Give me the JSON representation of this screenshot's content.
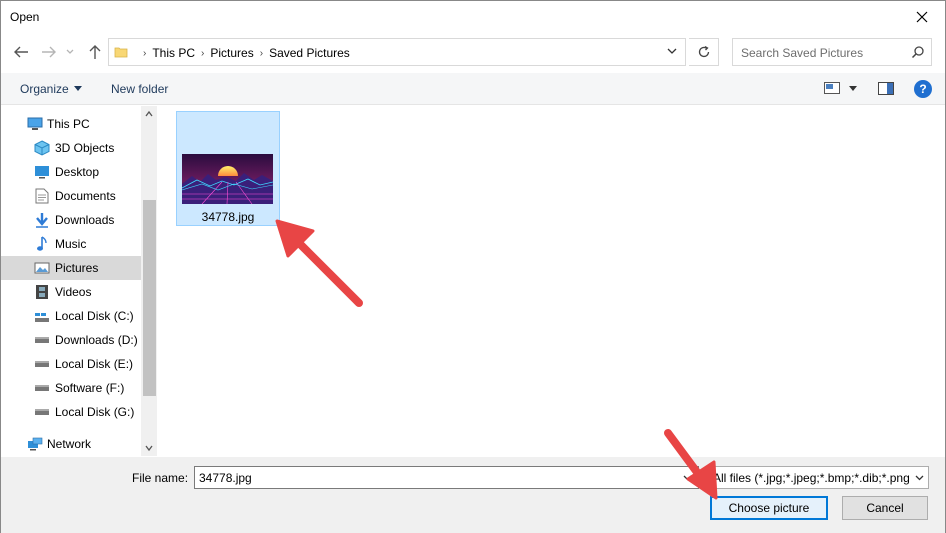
{
  "window": {
    "title": "Open"
  },
  "address": {
    "crumbs": [
      "This PC",
      "Pictures",
      "Saved Pictures"
    ]
  },
  "search": {
    "placeholder": "Search Saved Pictures"
  },
  "toolbar": {
    "organize_label": "Organize",
    "new_folder_label": "New folder",
    "help_label": "?"
  },
  "nav": {
    "items": [
      {
        "label": "This PC",
        "icon": "computer-icon"
      },
      {
        "label": "3D Objects",
        "icon": "cube-icon"
      },
      {
        "label": "Desktop",
        "icon": "desktop-icon"
      },
      {
        "label": "Documents",
        "icon": "document-icon"
      },
      {
        "label": "Downloads",
        "icon": "download-arrow-icon"
      },
      {
        "label": "Music",
        "icon": "music-note-icon"
      },
      {
        "label": "Pictures",
        "icon": "pictures-icon",
        "selected": true
      },
      {
        "label": "Videos",
        "icon": "film-icon"
      },
      {
        "label": "Local Disk (C:)",
        "icon": "windows-drive-icon"
      },
      {
        "label": "Downloads  (D:)",
        "icon": "drive-icon"
      },
      {
        "label": "Local Disk (E:)",
        "icon": "drive-icon"
      },
      {
        "label": "Software (F:)",
        "icon": "drive-icon"
      },
      {
        "label": "Local Disk (G:)",
        "icon": "drive-icon"
      },
      {
        "label": "Network",
        "icon": "network-icon"
      }
    ]
  },
  "files": [
    {
      "name": "34778.jpg",
      "selected": true
    }
  ],
  "bottom": {
    "file_name_label": "File name:",
    "file_name_value": "34778.jpg",
    "file_type_filter": "All files (*.jpg;*.jpeg;*.bmp;*.dib;*.png",
    "choose_label": "Choose picture",
    "cancel_label": "Cancel"
  },
  "colors": {
    "accent": "#0078d7",
    "selection_bg": "#cce8ff",
    "annotation_arrow": "#e84545"
  }
}
